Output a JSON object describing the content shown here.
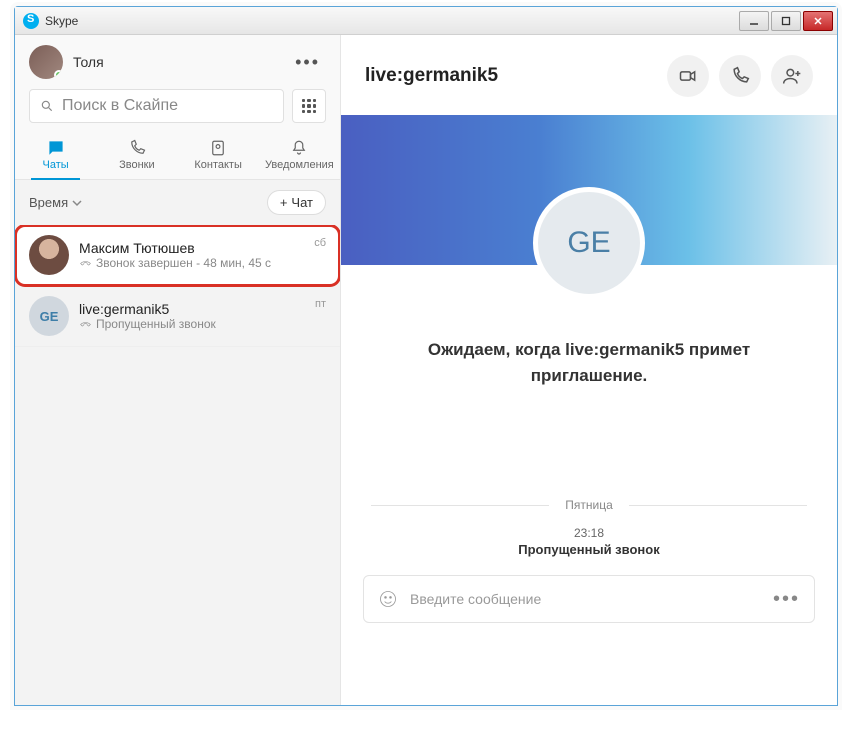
{
  "window": {
    "title": "Skype"
  },
  "user": {
    "display_name": "Толя"
  },
  "search": {
    "placeholder": "Поиск в Скайпе"
  },
  "tabs": {
    "chats": "Чаты",
    "calls": "Звонки",
    "contacts": "Контакты",
    "notifications": "Уведомления"
  },
  "filter": {
    "label": "Время",
    "new_chat": "Чат"
  },
  "chats": [
    {
      "name": "Максим Тютюшев",
      "subtitle": "Звонок завершен - 48 мин, 45 с",
      "time": "сб",
      "initials": "",
      "highlighted": true,
      "avatar_type": "photo"
    },
    {
      "name": "live:germanik5",
      "subtitle": "Пропущенный звонок",
      "time": "пт",
      "initials": "GE",
      "highlighted": false,
      "avatar_type": "initials"
    }
  ],
  "conversation": {
    "title": "live:germanik5",
    "avatar_initials": "GE",
    "invite_text": "Ожидаем, когда live:germanik5 примет приглашение.",
    "day_label": "Пятница",
    "missed_call": {
      "time": "23:18",
      "text": "Пропущенный звонок"
    },
    "composer_placeholder": "Введите сообщение"
  }
}
